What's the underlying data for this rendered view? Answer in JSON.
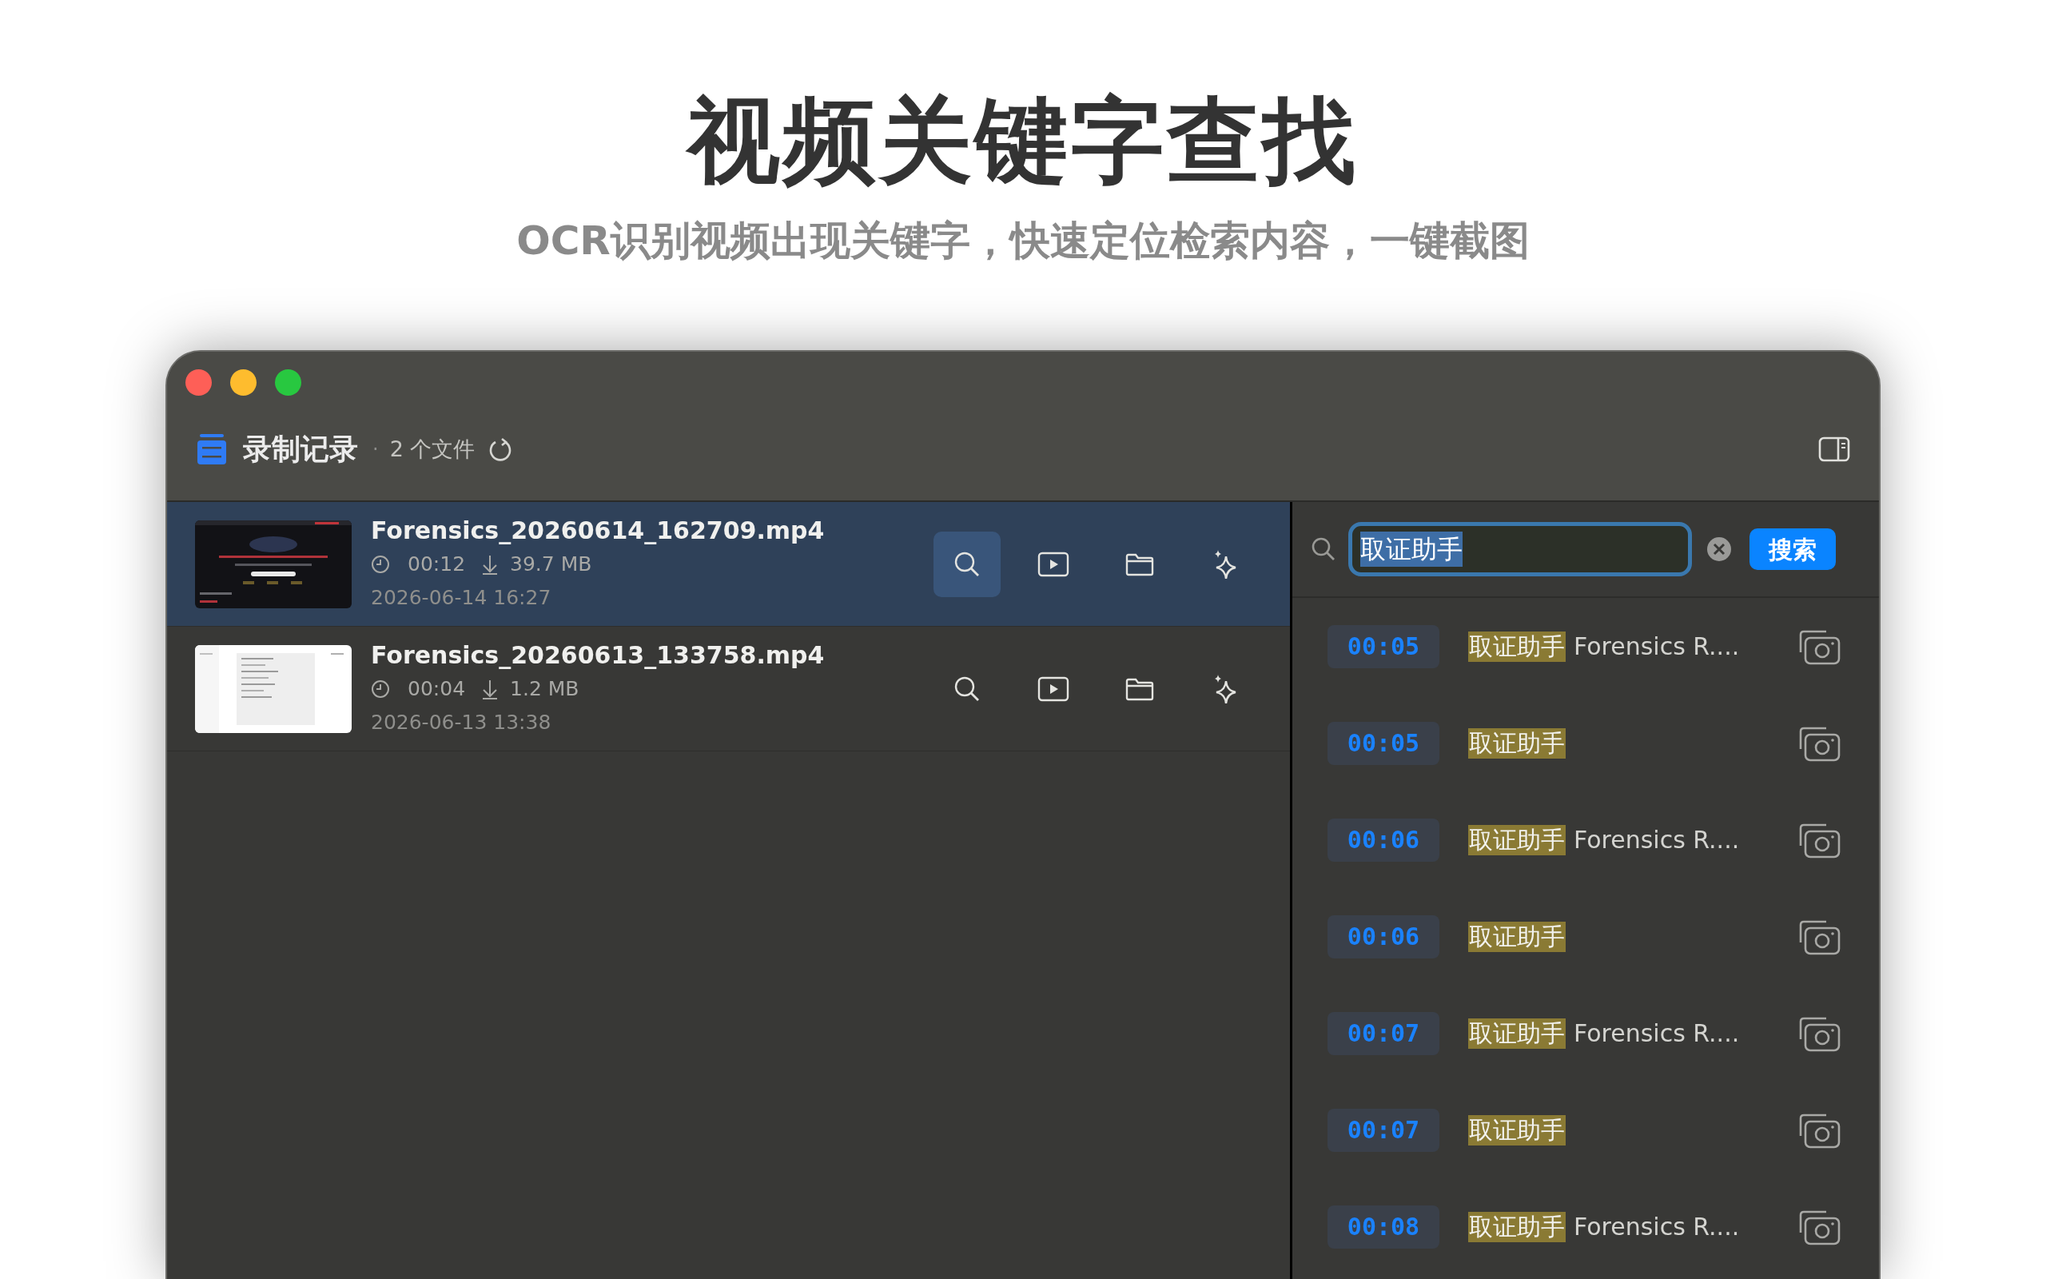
{
  "heading": {
    "title": "视频关键字查找",
    "subtitle": "OCR识别视频出现关键字，快速定位检索内容，一键截图"
  },
  "toolbar": {
    "title": "录制记录",
    "separator": "·",
    "count": "2 个文件"
  },
  "recordings": [
    {
      "name": "Forensics_20260614_162709.mp4",
      "duration": "00:12",
      "size": "39.7 MB",
      "date": "2026-06-14 16:27",
      "selected": true
    },
    {
      "name": "Forensics_20260613_133758.mp4",
      "duration": "00:04",
      "size": "1.2 MB",
      "date": "2026-06-13 13:38",
      "selected": false
    }
  ],
  "search": {
    "value": "取证助手",
    "button": "搜索"
  },
  "results": [
    {
      "time": "00:05",
      "match": "取证助手",
      "rest": "Forensics R...."
    },
    {
      "time": "00:05",
      "match": "取证助手"
    },
    {
      "time": "00:06",
      "match": "取证助手",
      "rest": "Forensics R...."
    },
    {
      "time": "00:06",
      "match": "取证助手"
    },
    {
      "time": "00:07",
      "match": "取证助手",
      "rest": "Forensics R...."
    },
    {
      "time": "00:07",
      "match": "取证助手"
    },
    {
      "time": "00:08",
      "match": "取证助手",
      "rest": "Forensics R...."
    }
  ]
}
